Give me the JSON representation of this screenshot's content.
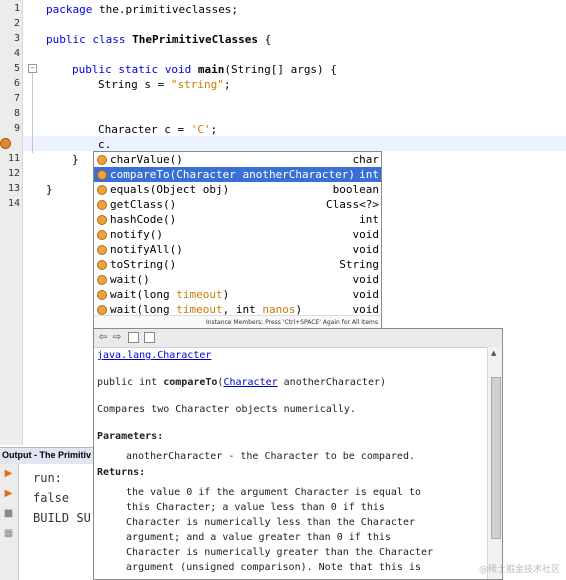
{
  "editor": {
    "line_numbers": [
      "1",
      "2",
      "3",
      "4",
      "5",
      "6",
      "7",
      "8",
      "9",
      "10",
      "11",
      "12",
      "13",
      "14"
    ],
    "lines": {
      "l1_kw": "package",
      "l1_rest": " the.primitiveclasses;",
      "l3_kw": "public class",
      "l3_name": "ThePrimitiveClasses",
      "l3_rest": " {",
      "l5_kw": "public static void",
      "l5_name": "main",
      "l5_rest": "(String[] args) {",
      "l6_a": "String s = ",
      "l6_str": "\"string\"",
      "l6_b": ";",
      "l9_a": "Character c = ",
      "l9_str": "'C'",
      "l9_b": ";",
      "l10": "c.",
      "l11": "}",
      "l13": "}"
    }
  },
  "completion": {
    "items": [
      {
        "name": "charValue()",
        "type": "char"
      },
      {
        "name": "compareTo(Character anotherCharacter)",
        "type": "int",
        "selected": true
      },
      {
        "name": "equals(Object obj)",
        "type": "boolean"
      },
      {
        "name": "getClass()",
        "type": "Class<?>"
      },
      {
        "name": "hashCode()",
        "type": "int"
      },
      {
        "name": "notify()",
        "type": "void"
      },
      {
        "name": "notifyAll()",
        "type": "void"
      },
      {
        "name": "toString()",
        "type": "String"
      },
      {
        "name": "wait()",
        "type": "void"
      },
      {
        "name": "wait(long timeout)",
        "type": "void"
      },
      {
        "name": "wait(long timeout, int nanos)",
        "type": "void"
      }
    ],
    "status": "Instance Members; Press 'Ctrl+SPACE' Again for All Items"
  },
  "javadoc": {
    "class_link": "java.lang.Character",
    "signature_pre": "public int ",
    "signature_method": "compareTo",
    "signature_open": "(",
    "signature_type": "Character",
    "signature_post": " anotherCharacter)",
    "description": "Compares two Character objects numerically.",
    "parameters_label": "Parameters:",
    "param_text": "anotherCharacter - the Character to be compared.",
    "returns_label": "Returns:",
    "returns_lines": [
      "the value 0 if the argument Character is equal to",
      "this Character; a value less than 0 if this",
      "Character is numerically less than the Character",
      "argument; and a value greater than 0 if this",
      "Character is numerically greater than the Character",
      "argument (unsigned comparison). Note that this is"
    ]
  },
  "output": {
    "title": "Output - The Primitiv",
    "lines": [
      "run:",
      "false",
      "BUILD SU"
    ]
  },
  "watermark": "@稀土掘金技术社区"
}
